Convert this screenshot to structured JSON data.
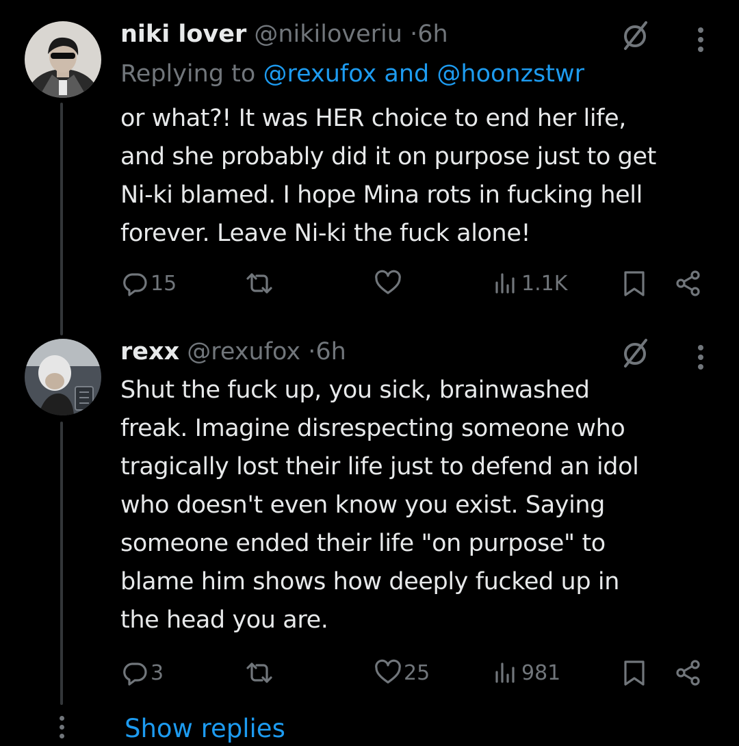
{
  "colors": {
    "background": "#000000",
    "text": "#e7e9ea",
    "muted": "#71767b",
    "link": "#1d9bf0",
    "thread_line": "#333639"
  },
  "tweets": [
    {
      "display_name": "niki lover",
      "handle": "@nikiloveriu",
      "separator": "·",
      "time": "6h",
      "replying_prefix": "Replying to",
      "replying_mention_1": "@rexufox",
      "replying_and": "and",
      "replying_mention_2": "@hoonzstwr",
      "text": "or what?! It was HER choice to end her life,\nand she probably did it on purpose just to get\nNi-ki blamed. I hope Mina rots in fucking hell\nforever. Leave Ni-ki the fuck alone!",
      "replies": "15",
      "reposts": "",
      "likes": "",
      "views": "1.1K",
      "icons": [
        "grok-icon",
        "more-icon",
        "reply-icon",
        "repost-icon",
        "like-icon",
        "views-icon",
        "bookmark-icon",
        "share-icon"
      ]
    },
    {
      "display_name": "rexx",
      "handle": "@rexufox",
      "separator": "·",
      "time": "6h",
      "text": "Shut the fuck up, you sick, brainwashed\nfreak. Imagine disrespecting someone who\ntragically lost their life just to defend an idol\nwho doesn't even know you exist. Saying\nsomeone ended their life \"on purpose\" to\nblame him shows how deeply fucked up in\nthe head you are.",
      "replies": "3",
      "reposts": "",
      "likes": "25",
      "views": "981",
      "icons": [
        "grok-icon",
        "more-icon",
        "reply-icon",
        "repost-icon",
        "like-icon",
        "views-icon",
        "bookmark-icon",
        "share-icon"
      ]
    }
  ],
  "show_replies_label": "Show replies"
}
